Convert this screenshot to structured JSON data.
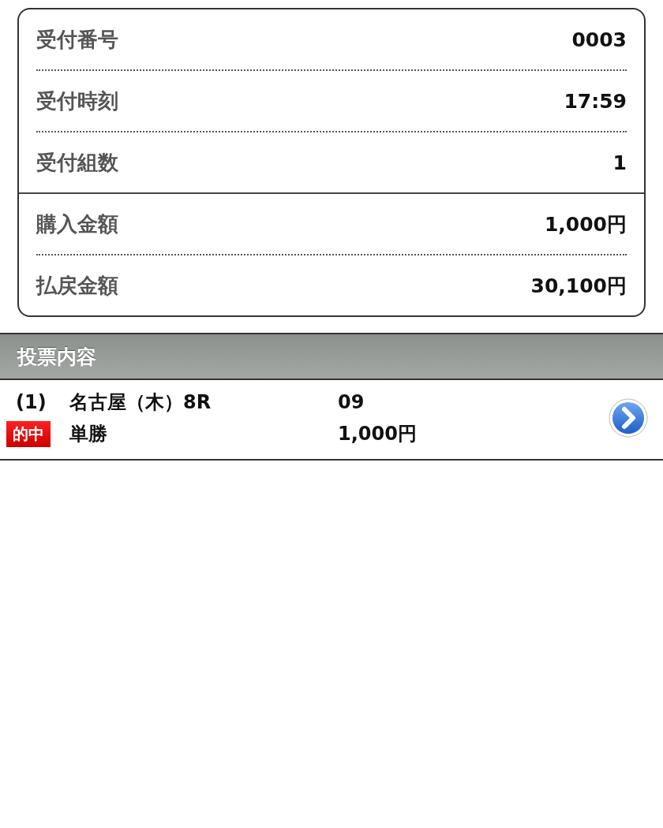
{
  "summary": {
    "groups": [
      {
        "rows": [
          {
            "label": "受付番号",
            "value": "0003"
          },
          {
            "label": "受付時刻",
            "value": "17:59"
          },
          {
            "label": "受付組数",
            "value": "1"
          }
        ]
      },
      {
        "rows": [
          {
            "label": "購入金額",
            "value": "1,000円"
          },
          {
            "label": "払戻金額",
            "value": "30,100円"
          }
        ]
      }
    ]
  },
  "section": {
    "title": "投票内容"
  },
  "bets": [
    {
      "index": "(1)",
      "race": "名古屋（木）8R",
      "selection": "09",
      "hit": true,
      "badge": "的中",
      "bet_type": "単勝",
      "amount": "1,000円"
    }
  ]
}
